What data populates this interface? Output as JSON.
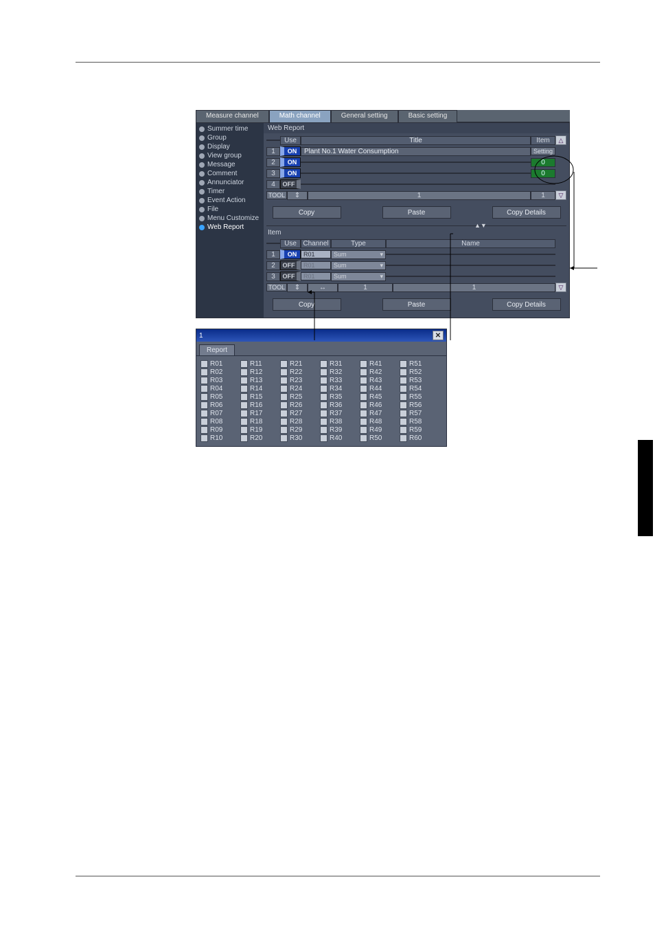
{
  "tabs": {
    "measure": "Measure channel",
    "math": "Math channel",
    "general": "General setting",
    "basic": "Basic setting"
  },
  "sidebar": {
    "items": [
      "Summer time",
      "Group",
      "Display",
      "View group",
      "Message",
      "Comment",
      "Annunciator",
      "Timer",
      "Event Action",
      "File",
      "Menu Customize",
      "Web Report"
    ],
    "selected": "Web Report"
  },
  "webreport": {
    "title": "Web Report",
    "headers": {
      "use": "Use",
      "title": "Title",
      "item": "Item",
      "setting": "Setting"
    },
    "rows": [
      {
        "n": "1",
        "use": "ON",
        "title": "Plant No.1 Water Consumption"
      },
      {
        "n": "2",
        "use": "ON",
        "title": ""
      },
      {
        "n": "3",
        "use": "ON",
        "title": ""
      },
      {
        "n": "4",
        "use": "OFF",
        "title": ""
      }
    ],
    "toolrow": {
      "label": "TOOL",
      "col1": "1",
      "col2": "1"
    },
    "greencells": [
      "0",
      "0"
    ],
    "buttons": {
      "copy": "Copy",
      "paste": "Paste",
      "copy_details": "Copy Details"
    }
  },
  "item": {
    "title": "Item",
    "headers": {
      "use": "Use",
      "channel": "Channel",
      "type": "Type",
      "name": "Name"
    },
    "rows": [
      {
        "n": "1",
        "use": "ON",
        "channel": "R01",
        "type": "Sum",
        "disabled": false
      },
      {
        "n": "2",
        "use": "OFF",
        "channel": "R01",
        "type": "Sum",
        "disabled": true
      },
      {
        "n": "3",
        "use": "OFF",
        "channel": "R01",
        "type": "Sum",
        "disabled": true
      }
    ],
    "toolrow": {
      "label": "TOOL",
      "col1": "1",
      "col2": "1"
    },
    "buttons": {
      "copy": "Copy",
      "paste": "Paste",
      "copy_details": "Copy Details"
    }
  },
  "popup": {
    "title": "1",
    "tab": "Report",
    "items": [
      "R01",
      "R02",
      "R03",
      "R04",
      "R05",
      "R06",
      "R07",
      "R08",
      "R09",
      "R10",
      "R11",
      "R12",
      "R13",
      "R14",
      "R15",
      "R16",
      "R17",
      "R18",
      "R19",
      "R20",
      "R21",
      "R22",
      "R23",
      "R24",
      "R25",
      "R26",
      "R27",
      "R28",
      "R29",
      "R30",
      "R31",
      "R32",
      "R33",
      "R34",
      "R35",
      "R36",
      "R37",
      "R38",
      "R39",
      "R40",
      "R41",
      "R42",
      "R43",
      "R44",
      "R45",
      "R46",
      "R47",
      "R48",
      "R49",
      "R50",
      "R51",
      "R52",
      "R53",
      "R54",
      "R55",
      "R56",
      "R57",
      "R58",
      "R59",
      "R60"
    ]
  },
  "icons": {
    "up": "△",
    "down": "▽",
    "grip": "▲▼",
    "resize": "↔",
    "updown": "⇕",
    "dd": "▾"
  }
}
